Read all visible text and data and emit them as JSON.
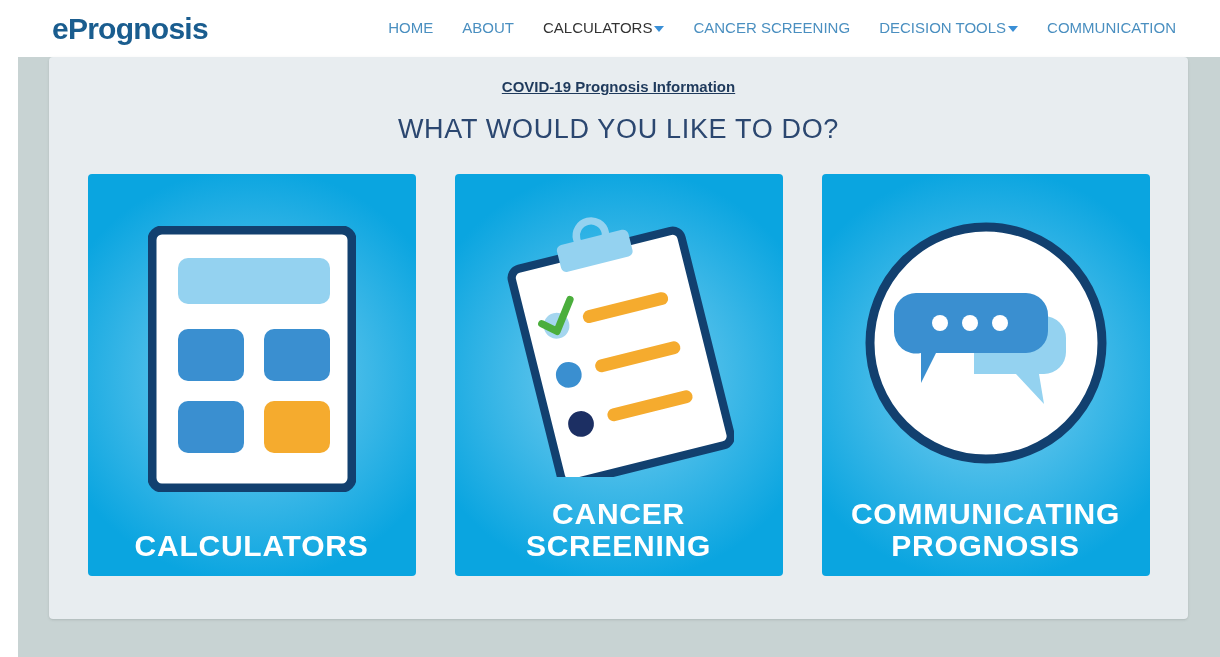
{
  "logo": "ePrognosis",
  "nav": [
    {
      "label": "HOME",
      "selected": false,
      "dropdown": false
    },
    {
      "label": "ABOUT",
      "selected": false,
      "dropdown": false
    },
    {
      "label": "CALCULATORS",
      "selected": true,
      "dropdown": true
    },
    {
      "label": "CANCER SCREENING",
      "selected": false,
      "dropdown": false
    },
    {
      "label": "DECISION TOOLS",
      "selected": false,
      "dropdown": true
    },
    {
      "label": "COMMUNICATION",
      "selected": false,
      "dropdown": false
    }
  ],
  "notice_link": "COVID-19 Prognosis Information",
  "heading": "WHAT WOULD YOU LIKE TO DO?",
  "cards": [
    {
      "kind": "calculator",
      "label_lines": [
        "CALCULATORS"
      ]
    },
    {
      "kind": "clipboard",
      "label_lines": [
        "CANCER",
        "SCREENING"
      ]
    },
    {
      "kind": "chat",
      "label_lines": [
        "COMMUNICATING",
        "PROGNOSIS"
      ]
    }
  ]
}
